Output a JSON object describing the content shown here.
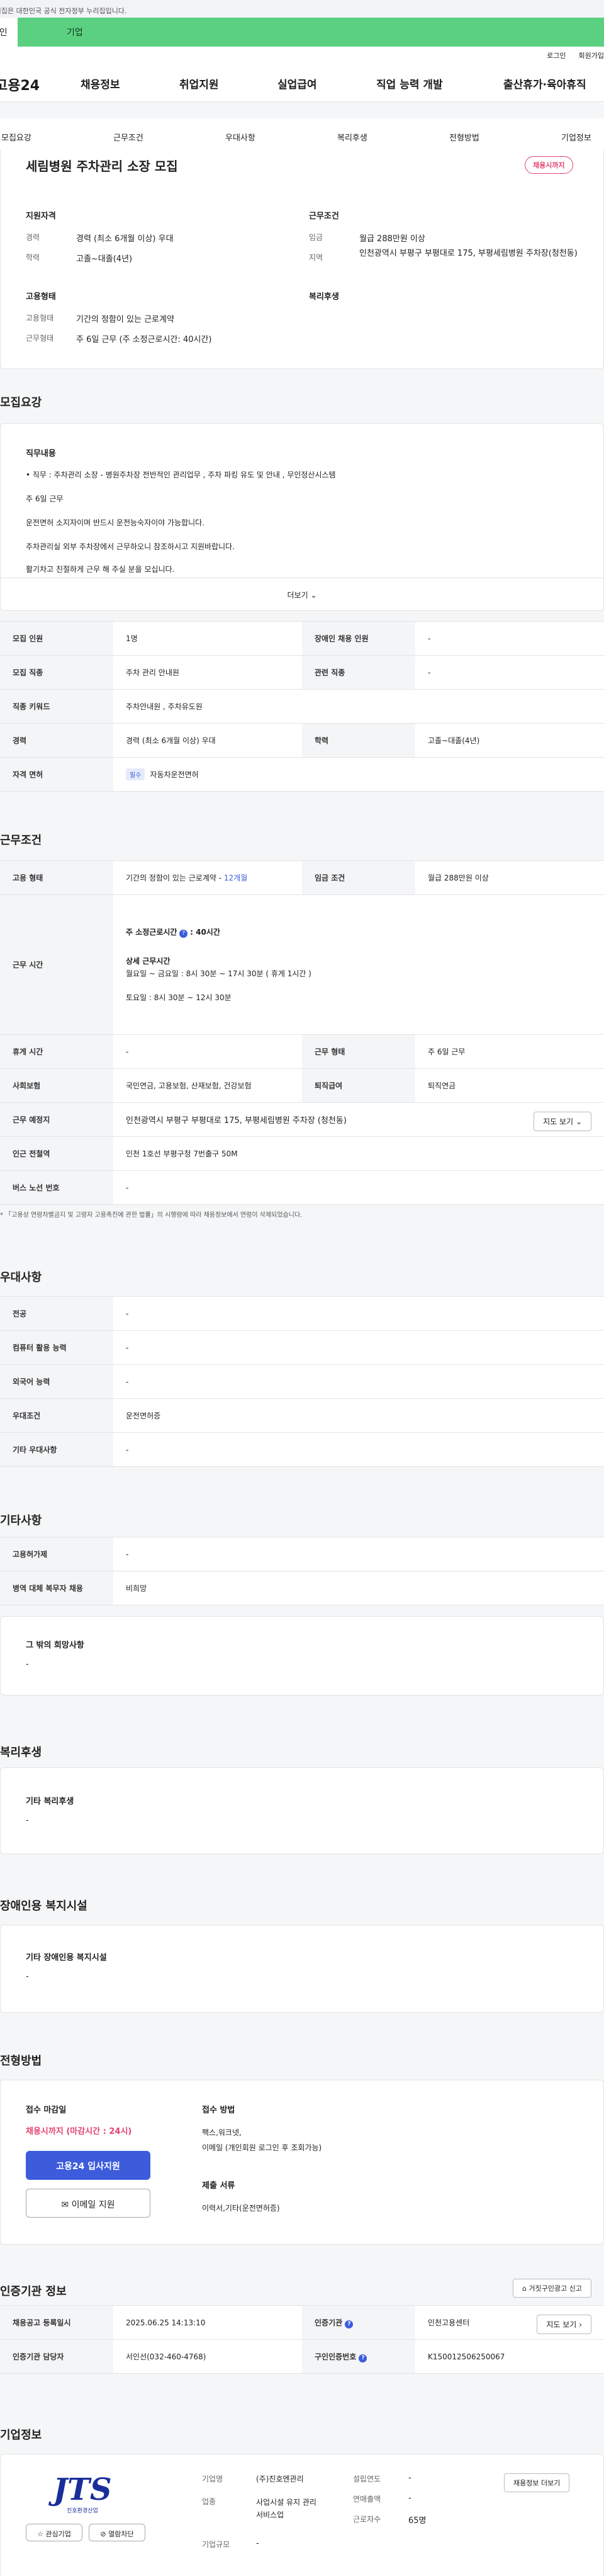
{
  "gov_banner": "이 누리집은 대한민국 공식 전자정부 누리집입니다.",
  "tabs": [
    "개인",
    "기업"
  ],
  "util": [
    "로그인",
    "회원가입"
  ],
  "logo": "고용24",
  "gnb": [
    "채용정보",
    "취업지원",
    "실업급여",
    "직업 능력 개발",
    "출산휴가·육아휴직"
  ],
  "subnav": [
    "모집요강",
    "근무조건",
    "우대사항",
    "복리후생",
    "전형방법",
    "기업정보"
  ],
  "job": {
    "title": "세림병원 주차관리 소장 모집",
    "badge": "채용시까지",
    "qual_title": "지원자격",
    "career_label": "경력",
    "career": "경력 (최소 6개월 이상) 우대",
    "edu_label": "학력",
    "edu": "고졸~대졸(4년)",
    "cond_title": "근무조건",
    "wage_label": "임금",
    "wage": "월급 288만원 이상",
    "area_label": "지역",
    "area": "인천광역시 부평구 부평대로 175, 부평세림병원 주차장(청천동)",
    "emp_title": "고용형태",
    "emp_label": "고용형태",
    "emp": "기간의 정함이 있는 근로계약",
    "form_label": "근무형태",
    "form": "주 6일 근무 (주 소정근로시간: 40시간)",
    "welfare_title": "복리후생"
  },
  "recruit": {
    "section": "모집요강",
    "duty_title": "직무내용",
    "lines": [
      "• 직무 : 주차관리 소장 - 병원주차장 전반적인 관리업무 , 주차 파킹 유도 및 안내 , 무인정산시스템",
      "주 6일 근무",
      "운전면허 소지자이며 반드시 운전능숙자이야 가능합니다.",
      "주차관리실 외부 주차장에서 근무하오니 참조하시고 지원바랍니다.",
      "활기차고 친절하게 근무 해 주실 분을 모십니다."
    ],
    "more": "더보기",
    "rows": [
      {
        "k1": "모집 인원",
        "v1": "1명",
        "k2": "장애인 채용 인원",
        "v2": "-"
      },
      {
        "k1": "모집 직종",
        "v1": "주차 관리 안내원",
        "k2": "관련 직종",
        "v2": "-"
      },
      {
        "k1": "직종 키워드",
        "v1": "주차안내원 , 주차유도원",
        "k2": "",
        "v2": ""
      },
      {
        "k1": "경력",
        "v1": "경력 (최소 6개월 이상) 우대",
        "k2": "학력",
        "v2": "고졸~대졸(4년)"
      },
      {
        "k1": "자격 면허",
        "v1": "자동차운전면허",
        "k2": "",
        "v2": ""
      }
    ],
    "license_tag": "필수"
  },
  "work": {
    "section": "근무조건",
    "emp_k": "고용 형태",
    "emp_v": "기간의 정함이 있는 근로계약 - ",
    "emp_months": "12개월",
    "wage_k": "임금 조건",
    "wage_v": "월급 288만원 이상",
    "time_k": "근무 시간",
    "weekly": "주 소정근로시간",
    "weekly_v": ": 40시간",
    "detail_title": "상세 근무시간",
    "detail1": "월요일 ~ 금요일 : 8시 30분 ~ 17시 30분 ( 휴게 1시간 )",
    "detail2": "토요일 : 8시 30분 ~ 12시 30분",
    "break_k": "휴게 시간",
    "break_v": "-",
    "form_k": "근무 형태",
    "form_v": "주 6일 근무",
    "ins_k": "사회보험",
    "ins_v": "국민연금, 고용보험, 산재보험, 건강보험",
    "ret_k": "퇴직급여",
    "ret_v": "퇴직연금",
    "place_k": "근무 예정지",
    "place_v": "인천광역시 부평구 부평대로 175, 부평세림병원 주차장 (청천동)",
    "map_btn": "지도 보기",
    "sub_k": "인근 전철역",
    "sub_v": "인천 1호선 부평구청 7번출구 50M",
    "bus_k": "버스 노선 번호",
    "bus_v": "-",
    "note": "* 「고용상 연령차별금지 및 고령자 고용촉진에 관한 법률」의 시행령에 따라 채용정보에서 연령이 삭제되었습니다."
  },
  "pref": {
    "section": "우대사항",
    "rows": [
      {
        "k": "전공",
        "v": "-"
      },
      {
        "k": "컴퓨터 활용 능력",
        "v": "-"
      },
      {
        "k": "외국어 능력",
        "v": "-"
      },
      {
        "k": "우대조건",
        "v": "운전면허증"
      },
      {
        "k": "기타 우대사항",
        "v": "-"
      }
    ]
  },
  "etc": {
    "section": "기타사항",
    "rows": [
      {
        "k": "고용허가제",
        "v": "-"
      },
      {
        "k": "병역 대체 복무자 채용",
        "v": "비희망"
      }
    ],
    "box_title": "그 밖의 희망사항",
    "box_val": "-"
  },
  "welfare": {
    "section": "복리후생",
    "box_title": "기타 복리후생",
    "box_val": "-"
  },
  "disab": {
    "section": "장애인용 복지시설",
    "box_title": "기타 장애인용 복지시설",
    "box_val": "-"
  },
  "select": {
    "section": "전형방법",
    "deadline_title": "접수 마감일",
    "deadline": "채용시까지 (마감시간 : 24시)",
    "apply_btn": "고용24 입사지원",
    "email_btn": "이메일 지원",
    "method_title": "접수 방법",
    "method": "팩스,워크넷,",
    "method2": "이메일 (개인회원 로그인 후 조회가능)",
    "docs_title": "제출 서류",
    "docs": "이력서,기타(운전면허증)"
  },
  "cert": {
    "section": "인증기관 정보",
    "report_btn": "거짓구인광고 신고",
    "reg_k": "채용공고 등록일시",
    "reg_v": "2025.06.25 14:13:10",
    "org_k": "인증기관",
    "org_v": "인천고용센터",
    "map_btn": "지도 보기",
    "mgr_k": "인증기관 담당자",
    "mgr_v": "서인선(032-460-4768)",
    "num_k": "구인인증번호",
    "num_v": "K150012506250067"
  },
  "company": {
    "section": "기업정보",
    "logo_text": "JTS",
    "logo_sub": "진호환경산업",
    "fav_btn": "관심기업",
    "block_btn": "열람차단",
    "list_btn": "채용정보 더보기",
    "name_k": "기업명",
    "name_v": "(주)진호엔관리",
    "ind_k": "업종",
    "ind_v": "사업시설 유지 관리 서비스업",
    "size_k": "기업규모",
    "size_v": "-",
    "year_k": "설립연도",
    "year_v": "-",
    "sales_k": "연매출액",
    "sales_v": "-",
    "emp_k": "근로자수",
    "emp_v": "65명"
  }
}
